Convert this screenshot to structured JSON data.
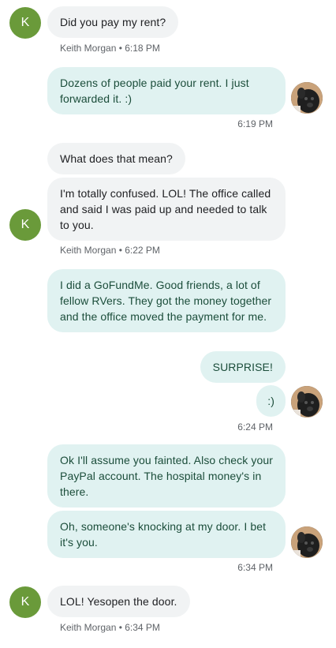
{
  "messages": [
    {
      "text": "Did you pay my rent?"
    },
    {
      "text": "Dozens of people paid your rent. I just forwarded it. :)"
    },
    {
      "text": "What does that mean?"
    },
    {
      "text": "I'm totally confused. LOL! The office called and said I was paid up and needed to talk to you."
    },
    {
      "text": "I did a GoFundMe. Good friends, a lot of fellow RVers. They got the money together and the office moved the payment for me."
    },
    {
      "text": "SURPRISE!"
    },
    {
      "text": ":)"
    },
    {
      "text": "Ok I'll assume you fainted. Also check your PayPal account. The hospital money's in there."
    },
    {
      "text": "Oh, someone's knocking at my door. I bet it's you."
    },
    {
      "text": "LOL! Yesopen the door."
    }
  ],
  "meta": {
    "m1": "Keith Morgan • 6:18 PM",
    "m2": "6:19 PM",
    "m3": "Keith Morgan • 6:22 PM",
    "m4": "6:24 PM",
    "m5": "6:34 PM",
    "m6": "Keith Morgan • 6:34 PM"
  },
  "contact": {
    "initial": "K",
    "name": "Keith Morgan"
  },
  "colors": {
    "incoming": "#f1f3f4",
    "outgoing": "#e0f2f1",
    "avatar": "#6a9a3a"
  }
}
